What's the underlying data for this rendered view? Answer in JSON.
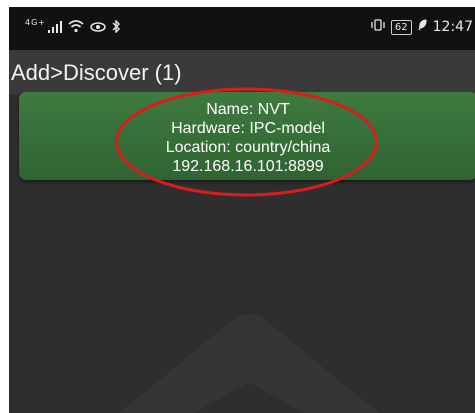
{
  "status_bar": {
    "network_label": "4G+",
    "signal_icon": "signal-bars-icon",
    "wifi_icon": "wifi-icon",
    "eye_icon": "eye-icon",
    "bluetooth_icon": "bluetooth-icon",
    "vibrate_icon": "vibrate-icon",
    "battery_level": "62",
    "battery_saver_icon": "leaf-icon",
    "time": "12:47"
  },
  "header": {
    "title": "Add>Discover (1)"
  },
  "device": {
    "name_line": "Name: NVT",
    "hardware_line": "Hardware: IPC-model",
    "location_line": "Location: country/china",
    "address_line": "192.168.16.101:8899"
  },
  "colors": {
    "card_green": "#3f7a3f",
    "highlight_red": "#d91c1c",
    "background": "#2e2e2e",
    "header": "#3a3a3a"
  }
}
